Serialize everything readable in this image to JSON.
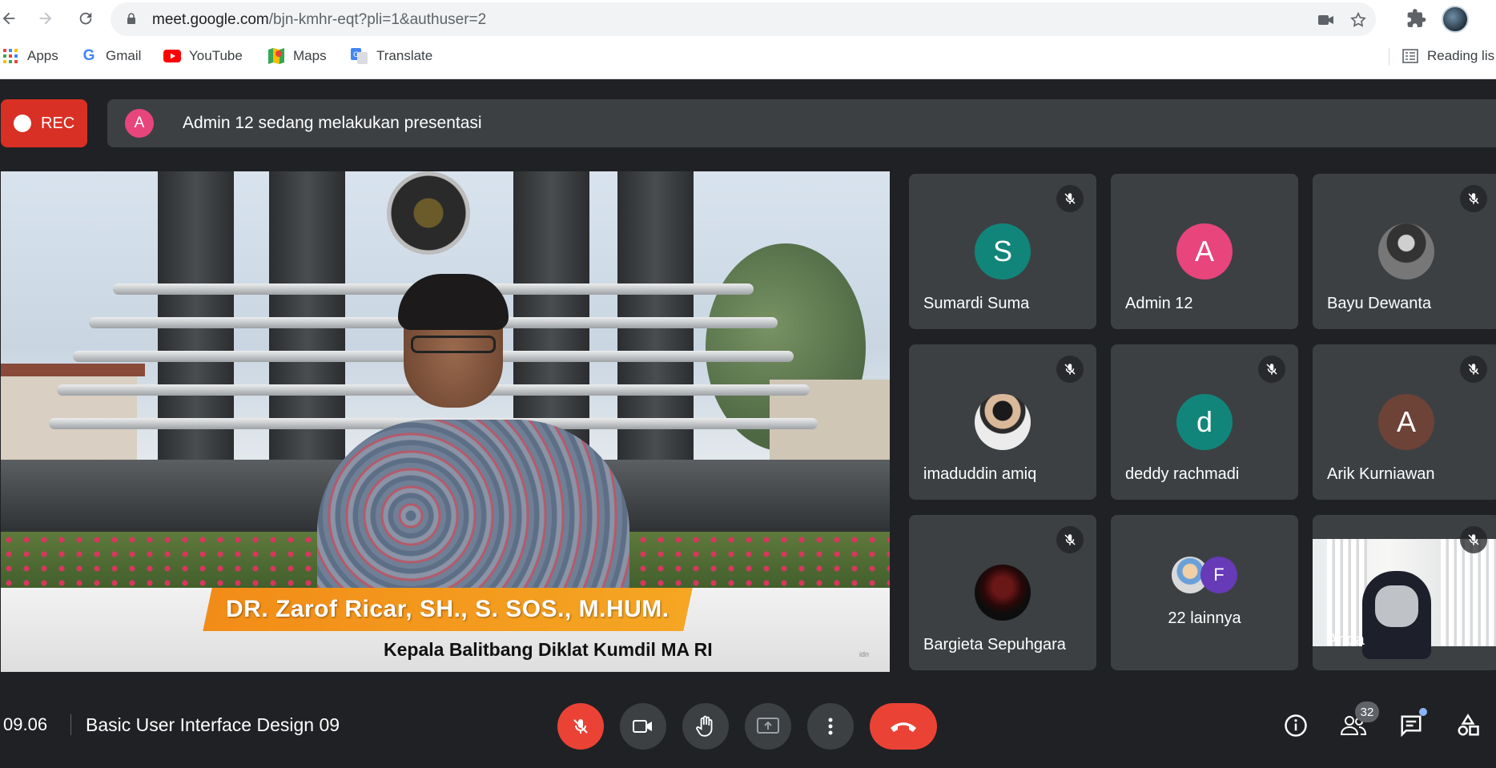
{
  "browser": {
    "url_main": "meet.google.com",
    "url_path": "/bjn-kmhr-eqt?pli=1&authuser=2",
    "bookmarks": [
      {
        "label": "Apps",
        "icon": "apps-grid-icon"
      },
      {
        "label": "Gmail",
        "icon": "google-g-icon"
      },
      {
        "label": "YouTube",
        "icon": "youtube-icon"
      },
      {
        "label": "Maps",
        "icon": "maps-icon"
      },
      {
        "label": "Translate",
        "icon": "translate-icon"
      }
    ],
    "reading_list": "Reading lis"
  },
  "topbar": {
    "rec_label": "REC",
    "presenter_initial": "A",
    "presenting_text": "Admin 12 sedang melakukan presentasi"
  },
  "presentation": {
    "title_banner": "DR. Zarof Ricar, SH., S. SOS., M.HUM.",
    "subtitle_banner": "Kepala Balitbang Diklat Kumdil MA RI",
    "watermark": "idn"
  },
  "participants": [
    {
      "name": "Sumardi Suma",
      "initial": "S",
      "color": "#12857a",
      "muted": true
    },
    {
      "name": "Admin 12",
      "initial": "A",
      "color": "#e8457d",
      "muted": false
    },
    {
      "name": "Bayu Dewanta",
      "initial": "",
      "color": "#555555",
      "muted": true,
      "photo": true
    },
    {
      "name": "imaduddin amiq",
      "initial": "",
      "color": "#e6e6e6",
      "muted": true,
      "photo": true
    },
    {
      "name": "deddy rachmadi",
      "initial": "d",
      "color": "#12857a",
      "muted": true
    },
    {
      "name": "Arik Kurniawan",
      "initial": "A",
      "color": "#6d4237",
      "muted": true
    },
    {
      "name": "Bargieta Sepuhgara",
      "initial": "",
      "color": "#3a0d0d",
      "muted": true,
      "photo": true
    }
  ],
  "others": {
    "label": "22 lainnya",
    "initial": "F",
    "color": "#673ab7"
  },
  "self_tile": {
    "name": "Anda",
    "muted": true
  },
  "bottombar": {
    "time": "09.06",
    "meeting_name": "Basic User Interface Design 09",
    "participant_count": "32"
  }
}
